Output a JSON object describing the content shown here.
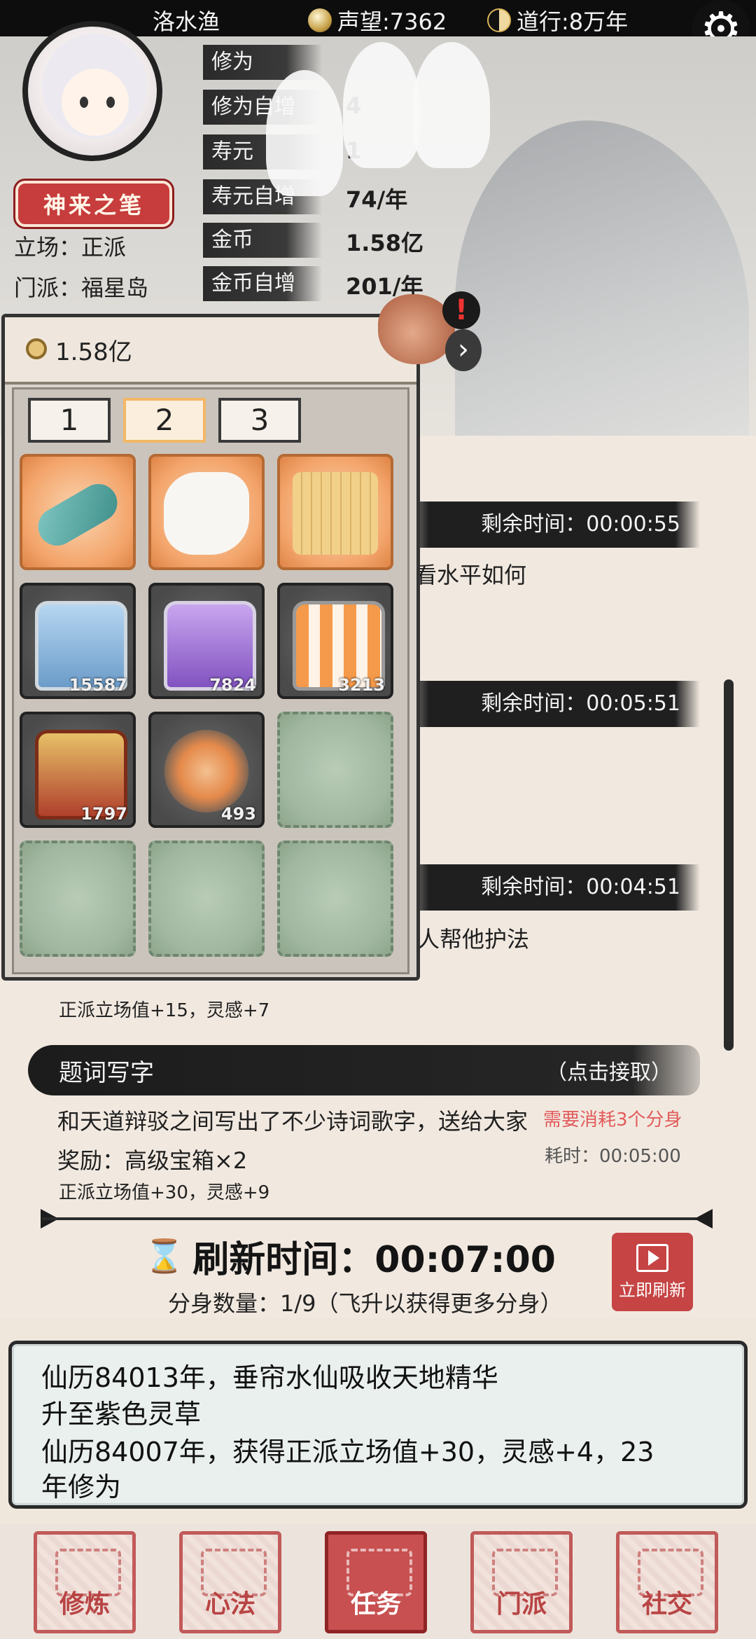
{
  "topbar": {
    "name": "洛水渔",
    "reputation": "声望:7362",
    "daoxing": "道行:8万年"
  },
  "profile": {
    "title_badge": "神来之笔",
    "stance": "立场：正派",
    "sect": "门派：福星岛"
  },
  "stats": [
    {
      "label": "修为",
      "value": ""
    },
    {
      "label": "修为自增",
      "value": "4"
    },
    {
      "label": "寿元",
      "value": "1"
    },
    {
      "label": "寿元自增",
      "value": "74/年"
    },
    {
      "label": "金币",
      "value": "1.58亿"
    },
    {
      "label": "金币自增",
      "value": "201/年"
    }
  ],
  "inventory": {
    "coin_total": "1.58亿",
    "tabs": [
      "1",
      "2",
      "3"
    ],
    "active_tab": "2",
    "items": [
      {
        "icon": "scroll-icon",
        "count": ""
      },
      {
        "icon": "paper-icon",
        "count": ""
      },
      {
        "icon": "bamboo-scroll-icon",
        "count": ""
      },
      {
        "icon": "blue-chest-icon",
        "count": "15587"
      },
      {
        "icon": "purple-chest-icon",
        "count": "7824"
      },
      {
        "icon": "orange-chest-icon",
        "count": "3213"
      },
      {
        "icon": "gold-chest-icon",
        "count": "1797"
      },
      {
        "icon": "swirl-orb-icon",
        "count": "493"
      }
    ]
  },
  "quests": {
    "q1": {
      "timer": "剩余时间：00:00:55",
      "desc_tail": "看水平如何"
    },
    "q2": {
      "timer": "剩余时间：00:05:51"
    },
    "q3": {
      "timer": "剩余时间：00:04:51",
      "desc_tail": "人帮他护法",
      "reward_tail": "正派立场值+15，灵感+7"
    },
    "q4": {
      "title": "题词写字",
      "action": "（点击接取）",
      "desc": "和天道辩驳之间写出了不少诗词歌字，送给大家",
      "cost": "需要消耗3个分身",
      "reward": "奖励：高级宝箱×2",
      "duration": "耗时：00:05:00",
      "reward_detail": "正派立场值+30，灵感+9"
    }
  },
  "refresh": {
    "label": "刷新时间：00:07:00",
    "clones": "分身数量：1/9（飞升以获得更多分身）",
    "button": "立即刷新"
  },
  "log": {
    "lines": [
      "仙历84013年，垂帘水仙吸收天地精华",
      "升至紫色灵草",
      "仙历84007年，获得正派立场值+30，灵感+4，23",
      "年修为"
    ]
  },
  "nav": [
    {
      "label": "修炼"
    },
    {
      "label": "心法"
    },
    {
      "label": "任务"
    },
    {
      "label": "门派"
    },
    {
      "label": "社交"
    }
  ],
  "colors": {
    "accent_red": "#c64444",
    "cost_red": "#e25b5b"
  }
}
